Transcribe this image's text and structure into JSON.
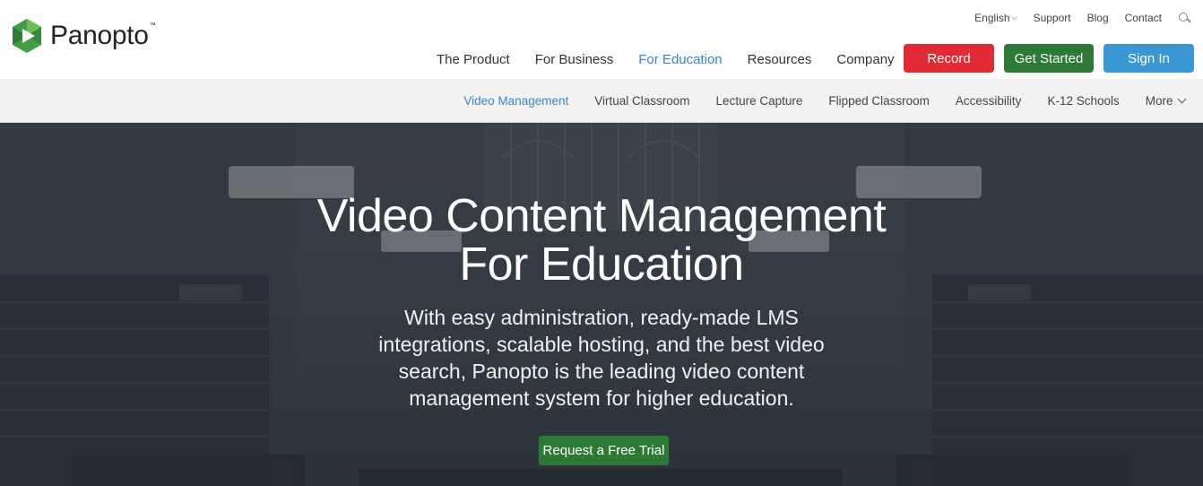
{
  "brand": {
    "name": "Panopto",
    "tm": "™",
    "logo_icon": "panopto-play-hexagon",
    "colors": {
      "green": "#3f9e47",
      "dark_green": "#2d7a36",
      "red": "#e12a34",
      "blue": "#3b96d4",
      "active_link": "#3a85c5"
    }
  },
  "utility_nav": {
    "language": "English",
    "support": "Support",
    "blog": "Blog",
    "contact": "Contact",
    "search_icon": "search-icon"
  },
  "main_nav": {
    "items": [
      "The Product",
      "For Business",
      "For Education",
      "Resources",
      "Company"
    ],
    "active": "For Education"
  },
  "cta": {
    "record": "Record",
    "get_started": "Get Started",
    "sign_in": "Sign In"
  },
  "sub_nav": {
    "items": [
      "Video Management",
      "Virtual Classroom",
      "Lecture Capture",
      "Flipped Classroom",
      "Accessibility",
      "K-12 Schools",
      "More"
    ],
    "active": "Video Management"
  },
  "hero": {
    "title_line1": "Video Content Management",
    "title_line2": "For Education",
    "subtitle": "With easy administration, ready-made LMS integrations, scalable hosting, and the best video search, Panopto is the leading video content management system for higher education.",
    "button": "Request a Free Trial"
  }
}
